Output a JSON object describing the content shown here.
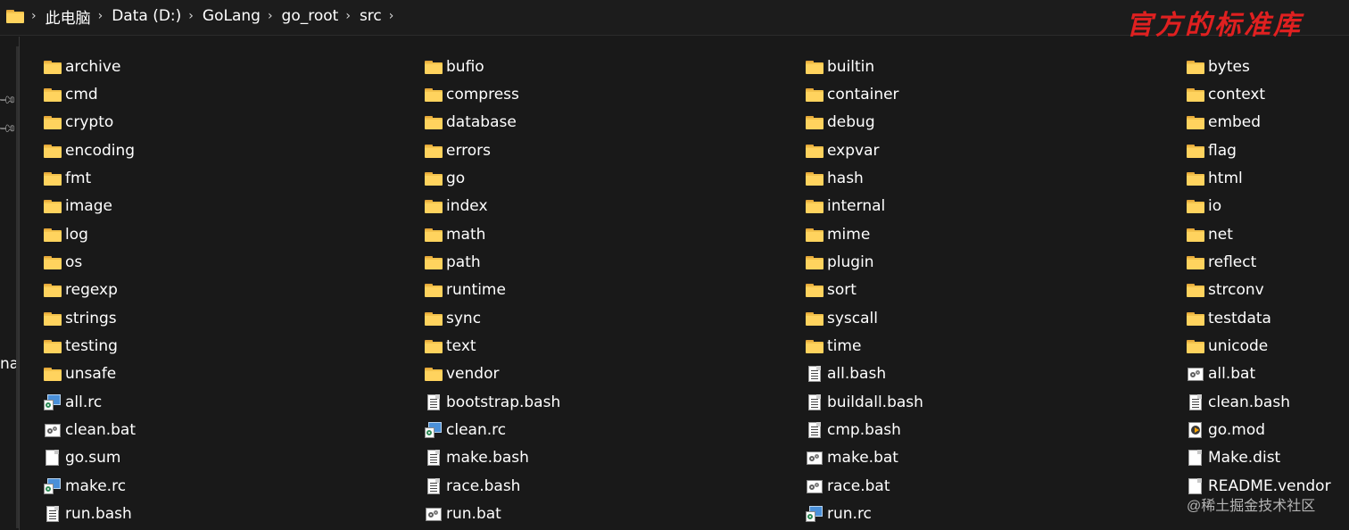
{
  "breadcrumb": [
    "此电脑",
    "Data (D:)",
    "GoLang",
    "go_root",
    "src"
  ],
  "annotation": "官方的标准库",
  "nav_pane_partial_text": "na",
  "credit": "@稀土掘金技术社区",
  "columns": [
    [
      {
        "name": "archive",
        "icon": "folder"
      },
      {
        "name": "cmd",
        "icon": "folder"
      },
      {
        "name": "crypto",
        "icon": "folder"
      },
      {
        "name": "encoding",
        "icon": "folder"
      },
      {
        "name": "fmt",
        "icon": "folder"
      },
      {
        "name": "image",
        "icon": "folder"
      },
      {
        "name": "log",
        "icon": "folder"
      },
      {
        "name": "os",
        "icon": "folder"
      },
      {
        "name": "regexp",
        "icon": "folder"
      },
      {
        "name": "strings",
        "icon": "folder"
      },
      {
        "name": "testing",
        "icon": "folder"
      },
      {
        "name": "unsafe",
        "icon": "folder"
      },
      {
        "name": "all.rc",
        "icon": "rc"
      },
      {
        "name": "clean.bat",
        "icon": "bat"
      },
      {
        "name": "go.sum",
        "icon": "blank"
      },
      {
        "name": "make.rc",
        "icon": "rc"
      },
      {
        "name": "run.bash",
        "icon": "doc"
      }
    ],
    [
      {
        "name": "bufio",
        "icon": "folder"
      },
      {
        "name": "compress",
        "icon": "folder"
      },
      {
        "name": "database",
        "icon": "folder"
      },
      {
        "name": "errors",
        "icon": "folder"
      },
      {
        "name": "go",
        "icon": "folder"
      },
      {
        "name": "index",
        "icon": "folder"
      },
      {
        "name": "math",
        "icon": "folder"
      },
      {
        "name": "path",
        "icon": "folder"
      },
      {
        "name": "runtime",
        "icon": "folder"
      },
      {
        "name": "sync",
        "icon": "folder"
      },
      {
        "name": "text",
        "icon": "folder"
      },
      {
        "name": "vendor",
        "icon": "folder"
      },
      {
        "name": "bootstrap.bash",
        "icon": "doc"
      },
      {
        "name": "clean.rc",
        "icon": "rc"
      },
      {
        "name": "make.bash",
        "icon": "doc"
      },
      {
        "name": "race.bash",
        "icon": "doc"
      },
      {
        "name": "run.bat",
        "icon": "bat"
      }
    ],
    [
      {
        "name": "builtin",
        "icon": "folder"
      },
      {
        "name": "container",
        "icon": "folder"
      },
      {
        "name": "debug",
        "icon": "folder"
      },
      {
        "name": "expvar",
        "icon": "folder"
      },
      {
        "name": "hash",
        "icon": "folder"
      },
      {
        "name": "internal",
        "icon": "folder"
      },
      {
        "name": "mime",
        "icon": "folder"
      },
      {
        "name": "plugin",
        "icon": "folder"
      },
      {
        "name": "sort",
        "icon": "folder"
      },
      {
        "name": "syscall",
        "icon": "folder"
      },
      {
        "name": "time",
        "icon": "folder"
      },
      {
        "name": "all.bash",
        "icon": "doc"
      },
      {
        "name": "buildall.bash",
        "icon": "doc"
      },
      {
        "name": "cmp.bash",
        "icon": "doc"
      },
      {
        "name": "make.bat",
        "icon": "bat"
      },
      {
        "name": "race.bat",
        "icon": "bat"
      },
      {
        "name": "run.rc",
        "icon": "rc"
      }
    ],
    [
      {
        "name": "bytes",
        "icon": "folder"
      },
      {
        "name": "context",
        "icon": "folder"
      },
      {
        "name": "embed",
        "icon": "folder"
      },
      {
        "name": "flag",
        "icon": "folder"
      },
      {
        "name": "html",
        "icon": "folder"
      },
      {
        "name": "io",
        "icon": "folder"
      },
      {
        "name": "net",
        "icon": "folder"
      },
      {
        "name": "reflect",
        "icon": "folder"
      },
      {
        "name": "strconv",
        "icon": "folder"
      },
      {
        "name": "testdata",
        "icon": "folder"
      },
      {
        "name": "unicode",
        "icon": "folder"
      },
      {
        "name": "all.bat",
        "icon": "bat"
      },
      {
        "name": "clean.bash",
        "icon": "doc"
      },
      {
        "name": "go.mod",
        "icon": "mod"
      },
      {
        "name": "Make.dist",
        "icon": "blank"
      },
      {
        "name": "README.vendor",
        "icon": "blank"
      }
    ]
  ]
}
